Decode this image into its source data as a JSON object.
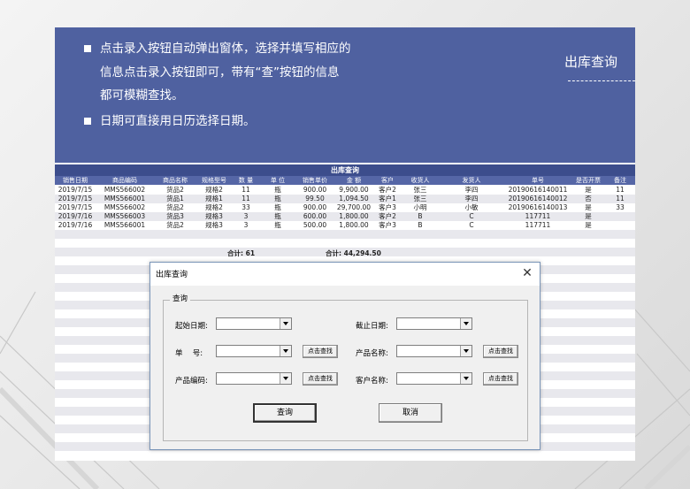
{
  "banner": {
    "bullet1_lines": [
      "点击录入按钮自动弹出窗体，选择并填写相应的",
      "信息点击录入按钮即可，带有“查”按钮的信息",
      "都可模糊查找。"
    ],
    "bullet2": "日期可直接用日历选择日期。",
    "title": "出库查询"
  },
  "table": {
    "title": "出库查询",
    "headers": [
      "销售日期",
      "商品编码",
      "商品名称",
      "规格型号",
      "数 量",
      "单 位",
      "销售单价",
      "金 额",
      "客户",
      "收货人",
      "发货人",
      "单号",
      "是否开票",
      "备注"
    ],
    "rows": [
      [
        "2019/7/15",
        "MMS566002",
        "货品2",
        "规格2",
        "11",
        "瓶",
        "900.00",
        "9,900.00",
        "客户2",
        "张三",
        "李四",
        "20190616140011",
        "是",
        "11"
      ],
      [
        "2019/7/15",
        "MMS566001",
        "货品1",
        "规格1",
        "11",
        "瓶",
        "99.50",
        "1,094.50",
        "客户1",
        "张三",
        "李四",
        "20190616140012",
        "否",
        "11"
      ],
      [
        "2019/7/15",
        "MMS566002",
        "货品2",
        "规格2",
        "33",
        "瓶",
        "900.00",
        "29,700.00",
        "客户3",
        "小明",
        "小敏",
        "20190616140013",
        "是",
        "33"
      ],
      [
        "2019/7/16",
        "MMS566003",
        "货品3",
        "规格3",
        "3",
        "瓶",
        "600.00",
        "1,800.00",
        "客户2",
        "B",
        "C",
        "117711",
        "是",
        ""
      ],
      [
        "2019/7/16",
        "MMS566001",
        "货品2",
        "规格3",
        "3",
        "瓶",
        "500.00",
        "1,800.00",
        "客户3",
        "B",
        "C",
        "117711",
        "是",
        ""
      ]
    ],
    "total_qty": "合计: 61",
    "total_amount": "合计: 44,294.50"
  },
  "dialog": {
    "title": "出库查询",
    "close_glyph": "✕",
    "group_label": "查询",
    "start_date_label": "起始日期:",
    "end_date_label": "截止日期:",
    "order_no_label": "单　 号:",
    "product_name_label": "产品名称:",
    "product_code_label": "产品编码:",
    "customer_name_label": "客户名称:",
    "search_btn": "点击查找",
    "query_btn": "查询",
    "cancel_btn": "取消"
  }
}
